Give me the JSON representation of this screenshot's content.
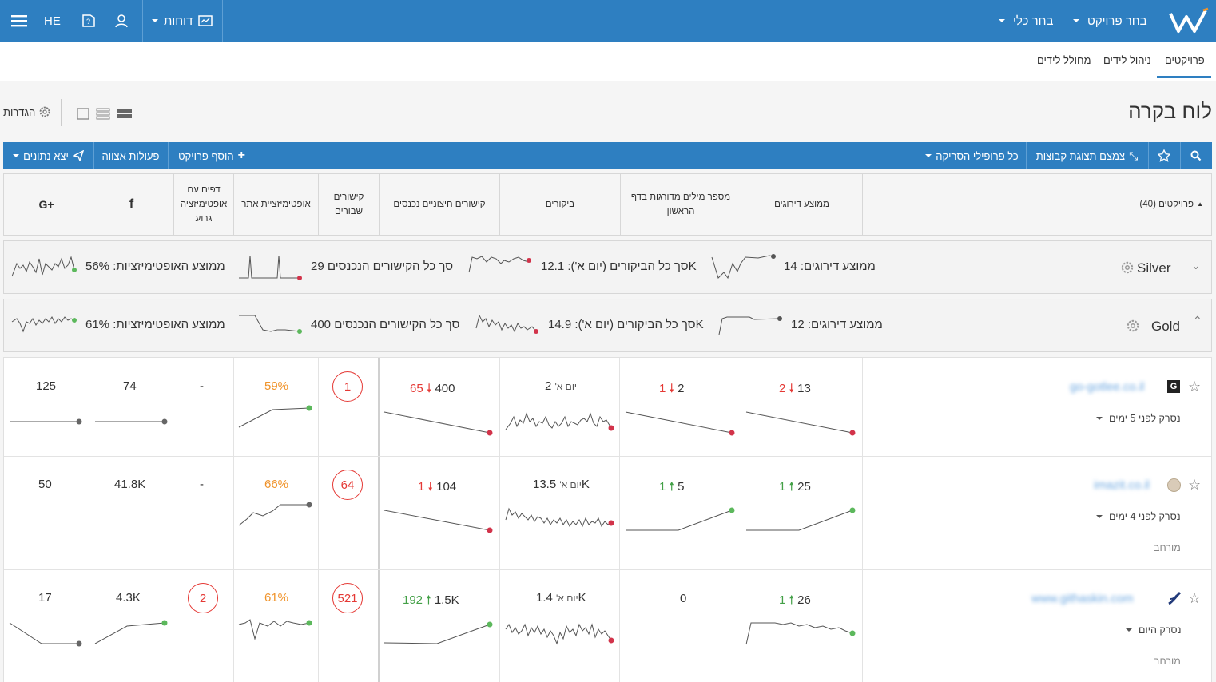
{
  "topbar": {
    "logo": "W",
    "choose_project": "בחר פרויקט",
    "choose_tool": "בחר כלי",
    "reports": "דוחות",
    "lang": "HE"
  },
  "subnav": {
    "tabs": [
      "פרויקטים",
      "ניהול לידים",
      "מחולל לידים"
    ],
    "active": 0
  },
  "page": {
    "title": "לוח בקרה",
    "settings": "הגדרות"
  },
  "toolbar": {
    "group_view": "צמצם תצוגת קבוצות",
    "scan_profiles": "כל פרופילי הסריקה",
    "add_project": "הוסף פרויקט",
    "bulk_actions": "פעולות אצווה",
    "export": "יצא נתונים"
  },
  "columns": {
    "projects": "פרויקטים (40)",
    "avg_rank": "ממוצע דירוגים",
    "first_page": "מספר מילים מדורגות בדף הראשון",
    "visits": "ביקורים",
    "backlinks": "קישורים חיצוניים נכנסים",
    "broken": "קישורים שבורים",
    "site_opt": "אופטימיזציית אתר",
    "group_opt": "דפים עם אופטימיזציה גרוע"
  },
  "groups": [
    {
      "name": "Silver",
      "avg_rank": "ממוצע דירוגים: 14",
      "visits": "סך כל הביקורים (יום א'): 12.1K",
      "backlinks": "סך כל הקישורים הנכנסים 29",
      "opt": "ממוצע האופטימיזציות: 56%"
    },
    {
      "name": "Gold",
      "avg_rank": "ממוצע דירוגים: 12",
      "visits": "סך כל הביקורים (יום א'): 14.9K",
      "backlinks": "סך כל הקישורים הנכנסים 400",
      "opt": "ממוצע האופטימיזציות: 61%"
    }
  ],
  "rows": [
    {
      "site": "go-gotlee.co.il",
      "favicon": "G",
      "scanned": "נסרק לפני 5 ימים",
      "extra": "",
      "rank": "13",
      "rank_delta": "2",
      "rank_dir": "down",
      "first": "2",
      "first_delta": "1",
      "first_dir": "down",
      "visits": "2",
      "visits_suffix": "יום א'",
      "links": "400",
      "links_delta": "65",
      "links_dir": "down",
      "broken": "1",
      "opt": "59%",
      "bad_pages": "-",
      "fb": "74",
      "gplus": "125"
    },
    {
      "site": "imazit.co.il",
      "favicon": "",
      "scanned": "נסרק לפני 4 ימים",
      "extra": "מורחב",
      "rank": "25",
      "rank_delta": "1",
      "rank_dir": "up",
      "first": "5",
      "first_delta": "1",
      "first_dir": "up",
      "visits": "13.5K",
      "visits_suffix": "יום א'",
      "links": "104",
      "links_delta": "1",
      "links_dir": "down",
      "broken": "64",
      "opt": "66%",
      "bad_pages": "-",
      "fb": "41.8K",
      "gplus": "50"
    },
    {
      "site": "www.githaskin.com",
      "favicon": "",
      "scanned": "נסרק היום",
      "extra": "מורחב",
      "rank": "26",
      "rank_delta": "1",
      "rank_dir": "up",
      "first": "0",
      "first_delta": "",
      "first_dir": "",
      "visits": "1.4K",
      "visits_suffix": "יום א'",
      "links": "1.5K",
      "links_delta": "192",
      "links_dir": "up",
      "broken": "521",
      "opt": "61%",
      "bad_pages": "2",
      "fb": "4.3K",
      "gplus": "17"
    }
  ],
  "colors": {
    "primary": "#2e7fc1",
    "down": "#e53935",
    "up": "#43a047",
    "opt": "#f0932a"
  }
}
